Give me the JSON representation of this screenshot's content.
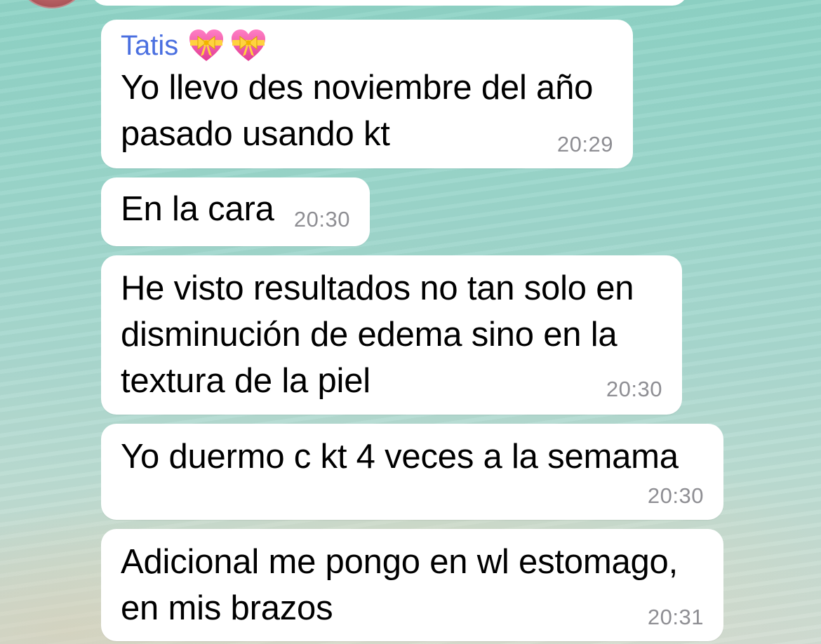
{
  "chat": {
    "messages": [
      {
        "sender": "Tatis",
        "sender_icons": [
          "heart-with-ribbon-icon",
          "heart-with-ribbon-icon"
        ],
        "lines": [
          "Yo llevo des noviembre del año",
          "pasado usando kt"
        ],
        "time": "20:29"
      },
      {
        "lines": [
          "En la cara"
        ],
        "time": "20:30"
      },
      {
        "lines": [
          "He visto resultados no tan solo en",
          "disminución de edema sino en la",
          "textura de la piel"
        ],
        "time": "20:30"
      },
      {
        "lines": [
          "Yo duermo c kt 4 veces a la semama"
        ],
        "time": "20:30"
      },
      {
        "lines": [
          "Adicional me pongo en wl estomago,",
          "en mis brazos"
        ],
        "time": "20:31"
      }
    ]
  },
  "colors": {
    "sender_name": "#4a6fe0",
    "bubble": "#ffffff",
    "timestamp": "#8e8e93",
    "background_water": "#9bd6cb",
    "background_sand": "#d2ddd3"
  }
}
